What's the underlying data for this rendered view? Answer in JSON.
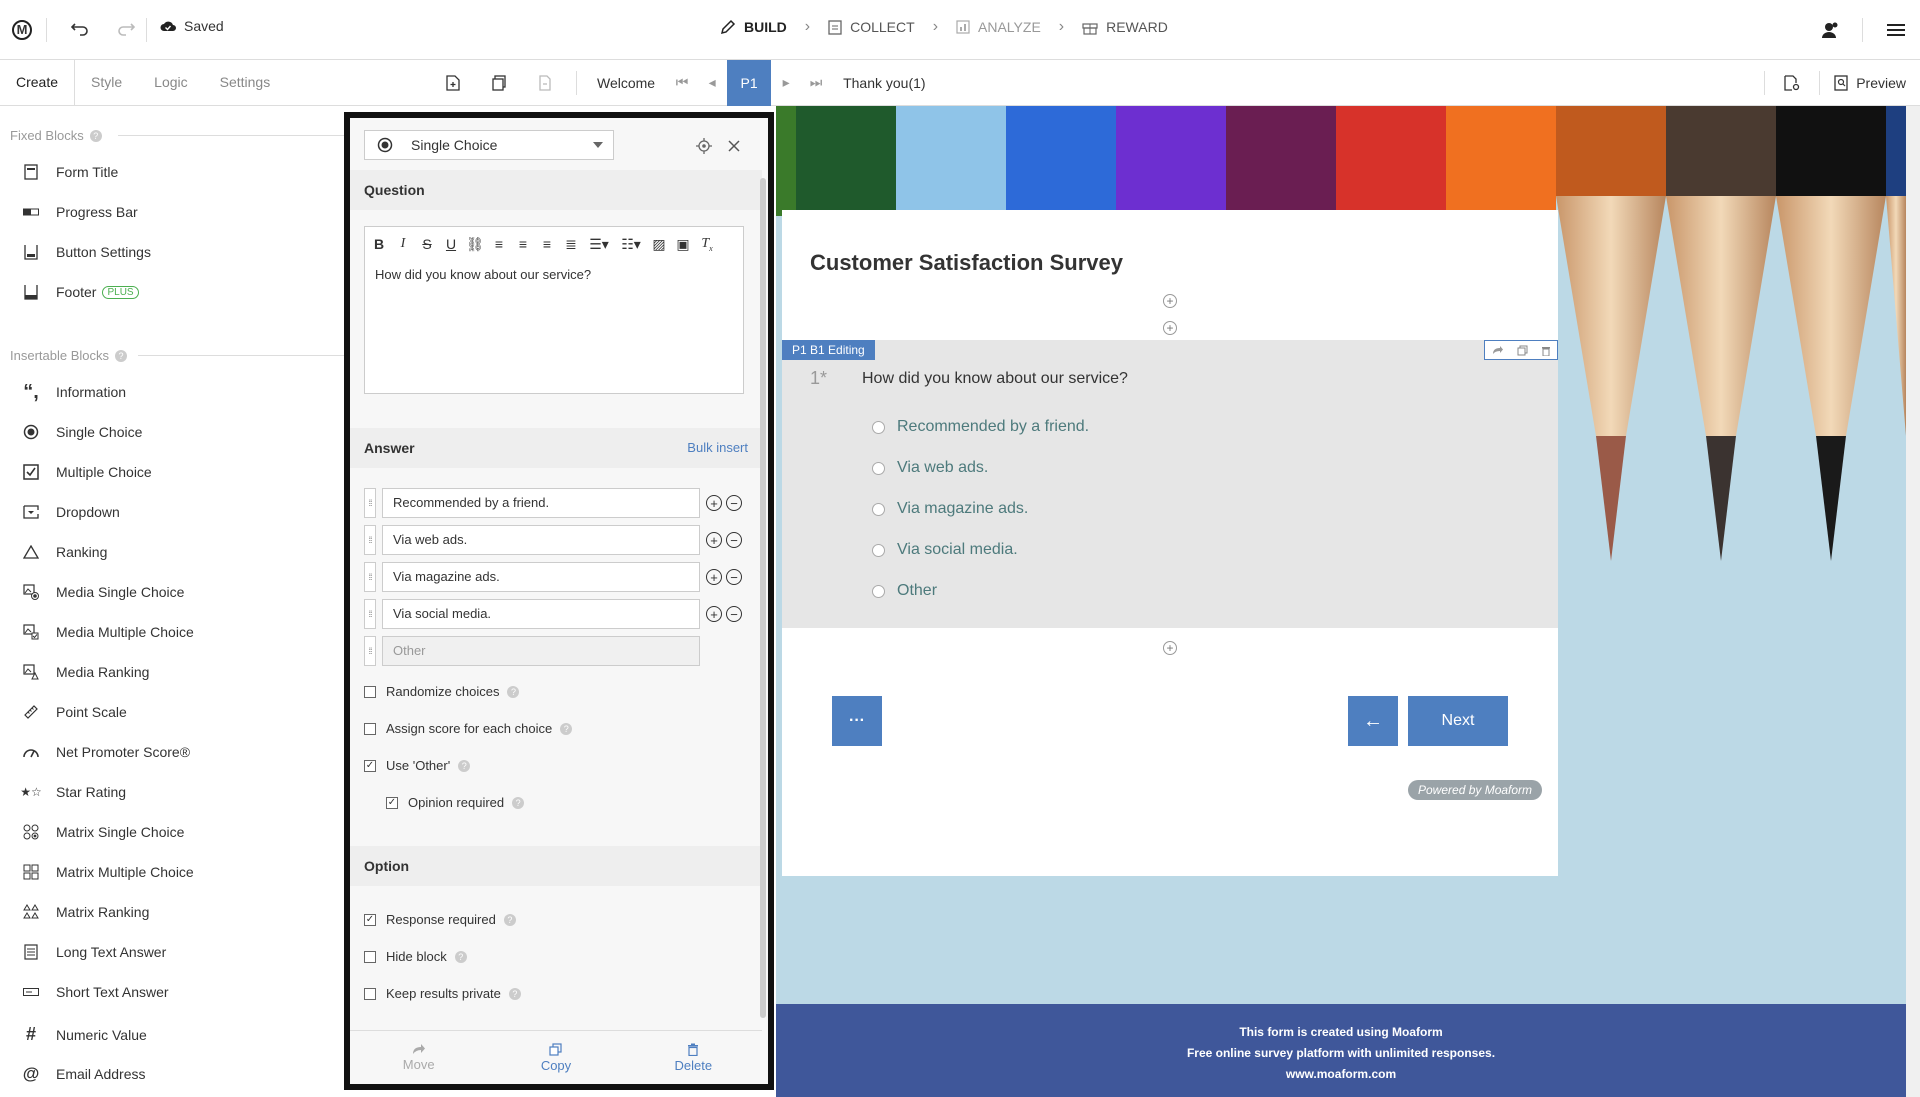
{
  "topbar": {
    "logo": "M",
    "saved_label": "Saved",
    "steps": [
      {
        "label": "BUILD",
        "icon": "pencil-icon",
        "state": "active"
      },
      {
        "label": "COLLECT",
        "icon": "clipboard-icon",
        "state": "normal"
      },
      {
        "label": "ANALYZE",
        "icon": "chart-icon",
        "state": "disabled"
      },
      {
        "label": "REWARD",
        "icon": "gift-icon",
        "state": "normal"
      }
    ]
  },
  "left_tabs": [
    "Create",
    "Style",
    "Logic",
    "Settings"
  ],
  "pagebar": {
    "welcome": "Welcome",
    "current_page": "P1",
    "thank_you": "Thank you(1)",
    "preview": "Preview"
  },
  "sidebar": {
    "fixed_title": "Fixed Blocks",
    "fixed": [
      {
        "label": "Form Title",
        "icon": "form-title-icon"
      },
      {
        "label": "Progress Bar",
        "icon": "progress-bar-icon"
      },
      {
        "label": "Button Settings",
        "icon": "button-settings-icon"
      },
      {
        "label": "Footer",
        "icon": "footer-icon",
        "badge": "PLUS"
      }
    ],
    "insertable_title": "Insertable Blocks",
    "insertable": [
      {
        "label": "Information",
        "icon": "quote-icon"
      },
      {
        "label": "Single Choice",
        "icon": "radio-icon"
      },
      {
        "label": "Multiple Choice",
        "icon": "checkbox-icon"
      },
      {
        "label": "Dropdown",
        "icon": "dropdown-icon"
      },
      {
        "label": "Ranking",
        "icon": "triangle-icon"
      },
      {
        "label": "Media Single Choice",
        "icon": "media-single-icon"
      },
      {
        "label": "Media Multiple Choice",
        "icon": "media-multiple-icon"
      },
      {
        "label": "Media Ranking",
        "icon": "media-ranking-icon"
      },
      {
        "label": "Point Scale",
        "icon": "ruler-icon"
      },
      {
        "label": "Net Promoter Score®",
        "icon": "gauge-icon"
      },
      {
        "label": "Star Rating",
        "icon": "star-icon"
      },
      {
        "label": "Matrix Single Choice",
        "icon": "matrix-single-icon"
      },
      {
        "label": "Matrix Multiple Choice",
        "icon": "matrix-multiple-icon"
      },
      {
        "label": "Matrix Ranking",
        "icon": "matrix-ranking-icon"
      },
      {
        "label": "Long Text Answer",
        "icon": "long-text-icon"
      },
      {
        "label": "Short Text Answer",
        "icon": "short-text-icon"
      },
      {
        "label": "Numeric Value",
        "icon": "hash-icon"
      },
      {
        "label": "Email Address",
        "icon": "at-icon"
      }
    ]
  },
  "editor": {
    "type_label": "Single Choice",
    "question_header": "Question",
    "question_text": "How did you know about our service?",
    "answer_header": "Answer",
    "bulk_insert": "Bulk insert",
    "answers": [
      "Recommended by a friend.",
      "Via web ads.",
      "Via magazine ads.",
      "Via social media."
    ],
    "other_placeholder": "Other",
    "checks": [
      {
        "label": "Randomize choices",
        "checked": false
      },
      {
        "label": "Assign score for each choice",
        "checked": false
      },
      {
        "label": "Use 'Other'",
        "checked": true
      },
      {
        "label": "Opinion required",
        "checked": true
      }
    ],
    "option_header": "Option",
    "option_checks": [
      {
        "label": "Response required",
        "checked": true
      },
      {
        "label": "Hide block",
        "checked": false
      },
      {
        "label": "Keep results private",
        "checked": false
      }
    ],
    "actions": {
      "move": "Move",
      "copy": "Copy",
      "delete": "Delete"
    }
  },
  "form": {
    "title": "Customer Satisfaction Survey",
    "editing_tag": "P1 B1 Editing",
    "question_number": "1*",
    "question": "How did you know about our service?",
    "options": [
      "Recommended by a friend.",
      "Via web ads.",
      "Via magazine ads.",
      "Via social media.",
      "Other"
    ],
    "more_button": "···",
    "back_button": "←",
    "next_button": "Next",
    "powered_by": "Powered by Moaform",
    "footer_lines": [
      "This form is created using Moaform",
      "Free online survey platform with unlimited responses.",
      "www.moaform.com"
    ]
  },
  "colors": {
    "accent": "#4e7fc0",
    "footer_bg": "#3f579a",
    "option_text": "#4d7a7c"
  }
}
